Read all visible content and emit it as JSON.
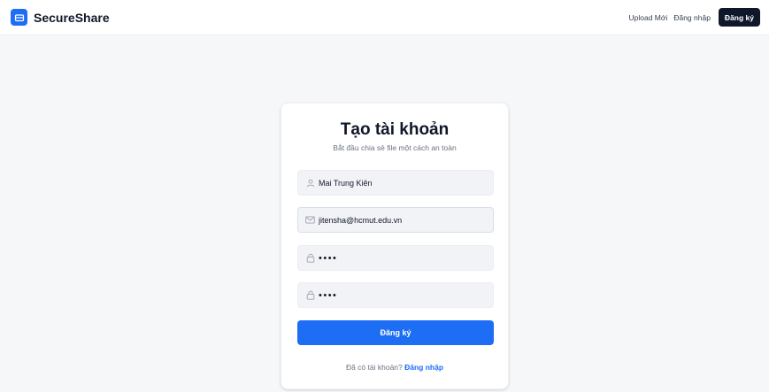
{
  "header": {
    "brand": "SecureShare",
    "nav": {
      "upload": "Upload Mới",
      "login": "Đăng nhập",
      "register": "Đăng ký"
    }
  },
  "register_card": {
    "title": "Tạo tài khoản",
    "subtitle": "Bắt đầu chia sẻ file một cách an toàn",
    "fields": {
      "name": {
        "value": "Mai Trung Kiên",
        "icon": "user-icon"
      },
      "email": {
        "value": "jitensha@hcmut.edu.vn",
        "icon": "mail-icon"
      },
      "password": {
        "value": "aaaa",
        "icon": "lock-icon"
      },
      "confirm_password": {
        "value": "aaaa",
        "icon": "lock-icon"
      }
    },
    "submit_label": "Đăng ký",
    "footer_prompt": "Đã có tài khoản?",
    "footer_link": "Đăng nhập"
  },
  "colors": {
    "accent": "#1d6ef5",
    "dark_button": "#0f172a",
    "page_bg": "#f6f7f9"
  }
}
